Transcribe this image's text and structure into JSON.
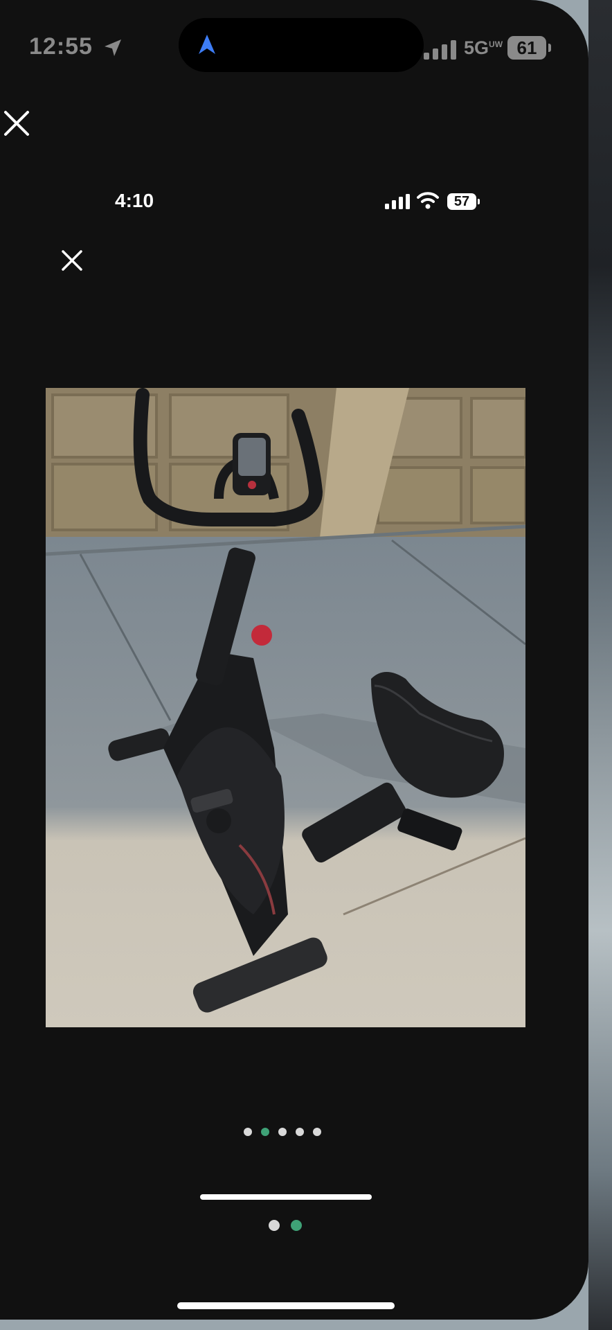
{
  "outer_status": {
    "time": "12:55",
    "network": "5G",
    "network_suffix": "UW",
    "battery": "61",
    "location_icon": "location-arrow-icon",
    "nav_icon": "navigation-arrow-icon"
  },
  "inner_status": {
    "time": "4:10",
    "battery": "57"
  },
  "photo": {
    "subject": "indoor cycling exercise bike on driveway"
  },
  "carousel": {
    "image_count": 5,
    "active_index": 1
  },
  "outer_pager": {
    "page_count": 2,
    "active_index": 1
  },
  "colors": {
    "background": "#111111",
    "accent_green": "#3fa277",
    "inactive_dot": "#d9d9d9"
  }
}
